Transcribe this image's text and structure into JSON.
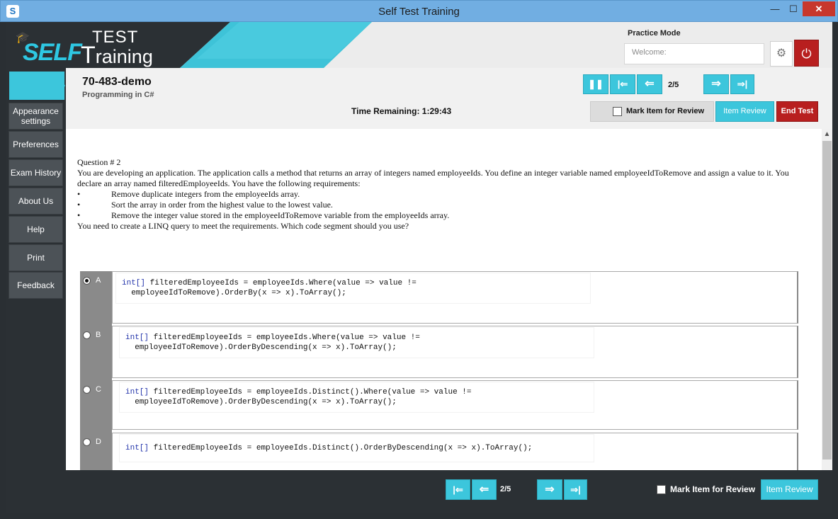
{
  "window": {
    "title": "Self Test Training",
    "minimize": "—",
    "maximize": "☐",
    "close": "✕"
  },
  "brand": {
    "self": "SELF",
    "test": "TEST",
    "training": "raining",
    "t_letter": "T"
  },
  "header": {
    "mode": "Practice Mode",
    "welcome_placeholder": "Welcome:",
    "settings_icon": "gear-icon",
    "power_icon": "power-icon"
  },
  "sidebar": {
    "items": [
      {
        "label": "Appearance settings"
      },
      {
        "label": "Preferences"
      },
      {
        "label": "Exam History"
      },
      {
        "label": "About Us"
      },
      {
        "label": "Help"
      },
      {
        "label": "Print"
      },
      {
        "label": "Feedback"
      }
    ]
  },
  "exam": {
    "code": "70-483-demo",
    "name": "Programming in C#",
    "time_label": "Time Remaining: 1:29:43"
  },
  "nav": {
    "page": "2/5",
    "pause": "❚❚",
    "first": "|⇐",
    "prev": "⇐",
    "next": "⇒",
    "last": "⇒|"
  },
  "toolbar": {
    "mark_label": "Mark Item for Review",
    "item_review": "Item Review",
    "end_test": "End Test"
  },
  "question": {
    "number": "Question # 2",
    "text": "You are developing an application. The application calls a method that returns an array of integers named employeeIds. You define an integer variable named employeeIdToRemove and assign a value to it. You declare an array named filteredEmployeeIds. You have the following requirements:",
    "bullets": [
      "Remove duplicate integers from the employeeIds array.",
      "Sort the array in order from the highest value to the lowest value.",
      "Remove the integer value stored in the employeeIdToRemove variable from the employeeIds array."
    ],
    "bullet_char": "•",
    "prompt": "You need to create a LINQ query to meet the requirements. Which code segment should you use?"
  },
  "options": [
    {
      "letter": "A",
      "selected": true,
      "kw": "int[]",
      "line1": " filteredEmployeeIds = employeeIds.Where(value => value !=",
      "line2": "  employeeIdToRemove).OrderBy(x => x).ToArray();"
    },
    {
      "letter": "B",
      "selected": false,
      "kw": "int[]",
      "line1": " filteredEmployeeIds = employeeIds.Where(value => value !=",
      "line2": "  employeeIdToRemove).OrderByDescending(x => x).ToArray();"
    },
    {
      "letter": "C",
      "selected": false,
      "kw": "int[]",
      "line1": " filteredEmployeeIds = employeeIds.Distinct().Where(value => value !=",
      "line2": "  employeeIdToRemove).OrderByDescending(x => x).ToArray();"
    },
    {
      "letter": "D",
      "selected": false,
      "kw": "int[]",
      "line1": " filteredEmployeeIds = employeeIds.Distinct().OrderByDescending(x => x).ToArray();",
      "line2": ""
    }
  ],
  "bottom": {
    "page": "2/5",
    "mark_label": "Mark Item for Review",
    "item_review": "Item Review"
  },
  "colors": {
    "accent": "#3cc6dc",
    "danger": "#b81f1f",
    "sidebar": "#4c5257",
    "titlebar": "#71aee2"
  }
}
